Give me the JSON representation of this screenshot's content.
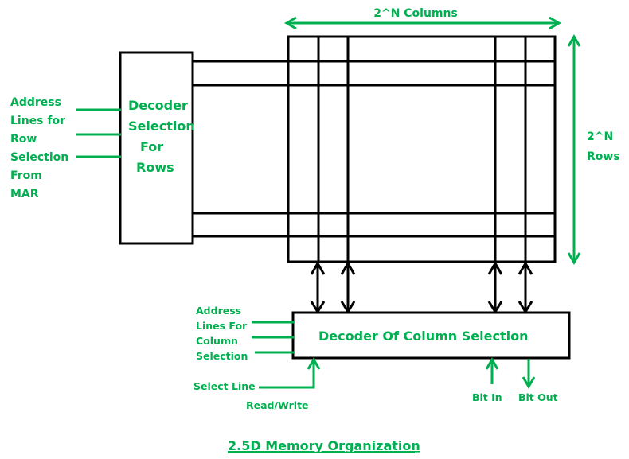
{
  "title": "2.5D Memory Organization",
  "colors": {
    "label": "#00b050",
    "line": "#000000"
  },
  "columns_label": "2^N Columns",
  "rows_label": [
    "2^N",
    "Rows"
  ],
  "row_decoder": {
    "label": [
      "Decoder",
      "Selection",
      "For",
      "Rows"
    ],
    "input_label": [
      "Address",
      "Lines for",
      "Row",
      "Selection",
      "From",
      "MAR"
    ]
  },
  "column_decoder": {
    "label": "Decoder Of Column Selection",
    "input_label": [
      "Address",
      "Lines For",
      "Column",
      "Selection"
    ],
    "select_line_label": "Select Line",
    "read_write_label": "Read/Write",
    "bit_in_label": "Bit In",
    "bit_out_label": "Bit Out"
  }
}
